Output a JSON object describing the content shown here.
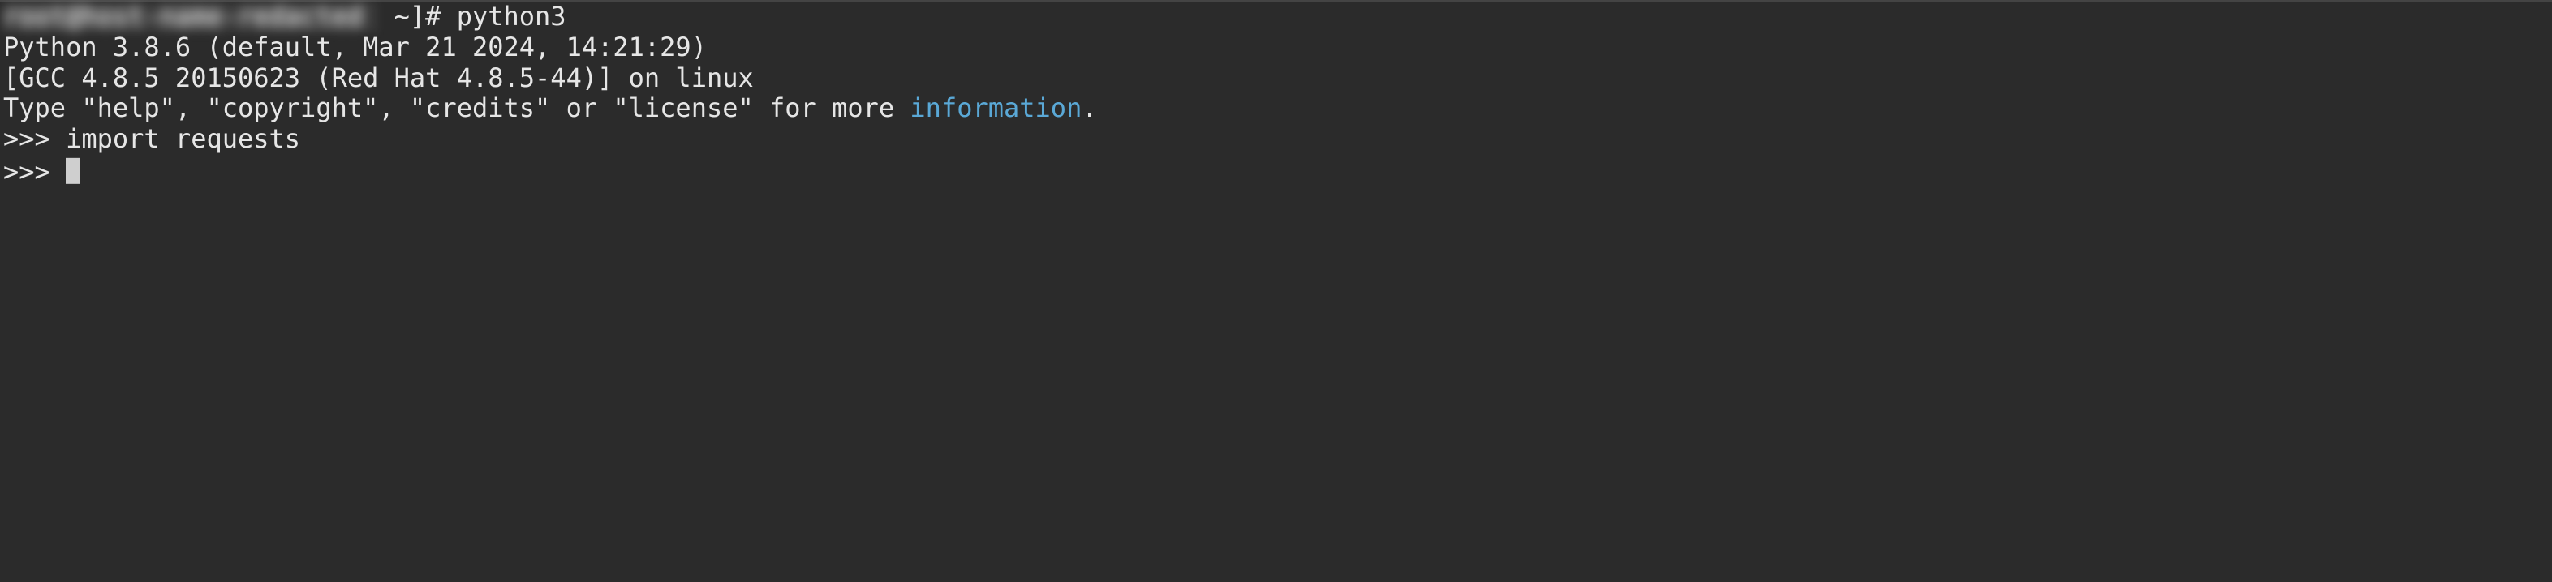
{
  "terminal": {
    "shell_prompt": {
      "hidden_part": "root@host-name-redacted ",
      "visible_suffix": " ~]# ",
      "command": "python3"
    },
    "python_banner": {
      "line1": "Python 3.8.6 (default, Mar 21 2024, 14:21:29)",
      "line2": "[GCC 4.8.5 20150623 (Red Hat 4.8.5-44)] on linux",
      "line3_prefix": "Type \"help\", \"copyright\", \"credits\" or \"license\" for more ",
      "line3_link": "information",
      "line3_suffix": "."
    },
    "repl": {
      "prompt1": ">>> ",
      "input1": "import requests",
      "prompt2": ">>> "
    }
  }
}
